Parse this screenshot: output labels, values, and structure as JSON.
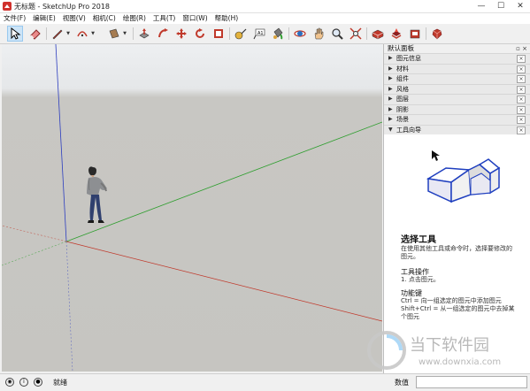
{
  "window": {
    "title": "无标题 - SketchUp Pro 2018"
  },
  "menu": [
    "文件(F)",
    "编辑(E)",
    "视图(V)",
    "相机(C)",
    "绘图(R)",
    "工具(T)",
    "窗口(W)",
    "帮助(H)"
  ],
  "tray": {
    "title": "默认面板",
    "controls": "▫ ×",
    "panels": [
      {
        "label": "图元信息",
        "expanded": false
      },
      {
        "label": "材料",
        "expanded": false
      },
      {
        "label": "组件",
        "expanded": false
      },
      {
        "label": "风格",
        "expanded": false
      },
      {
        "label": "图层",
        "expanded": false
      },
      {
        "label": "阴影",
        "expanded": false
      },
      {
        "label": "场景",
        "expanded": false
      },
      {
        "label": "工具向导",
        "expanded": true
      }
    ],
    "instructor": {
      "title": "选择工具",
      "description": "在使用其他工具或命令时，选择要修改的图元。",
      "operation_heading": "工具操作",
      "operation_text": "1. 点击图元。",
      "keys_heading": "功能键",
      "keys_text": "Ctrl = 向一组选定的图元中添加图元 Shift+Ctrl = 从一组选定的图元中去掉某个图元"
    }
  },
  "statusbar": {
    "status": "就绪",
    "measurements_label": "数值",
    "measurements_value": ""
  },
  "watermark": {
    "name": "当下软件园",
    "url": "www.downxia.com"
  },
  "colors": {
    "axis_red": "#c0392b",
    "axis_green": "#2e9e2e",
    "axis_blue": "#2c3dbf",
    "ground": "#c6c5c1",
    "sky": "#e9ebed",
    "selected_tool": "#cce4f7"
  }
}
